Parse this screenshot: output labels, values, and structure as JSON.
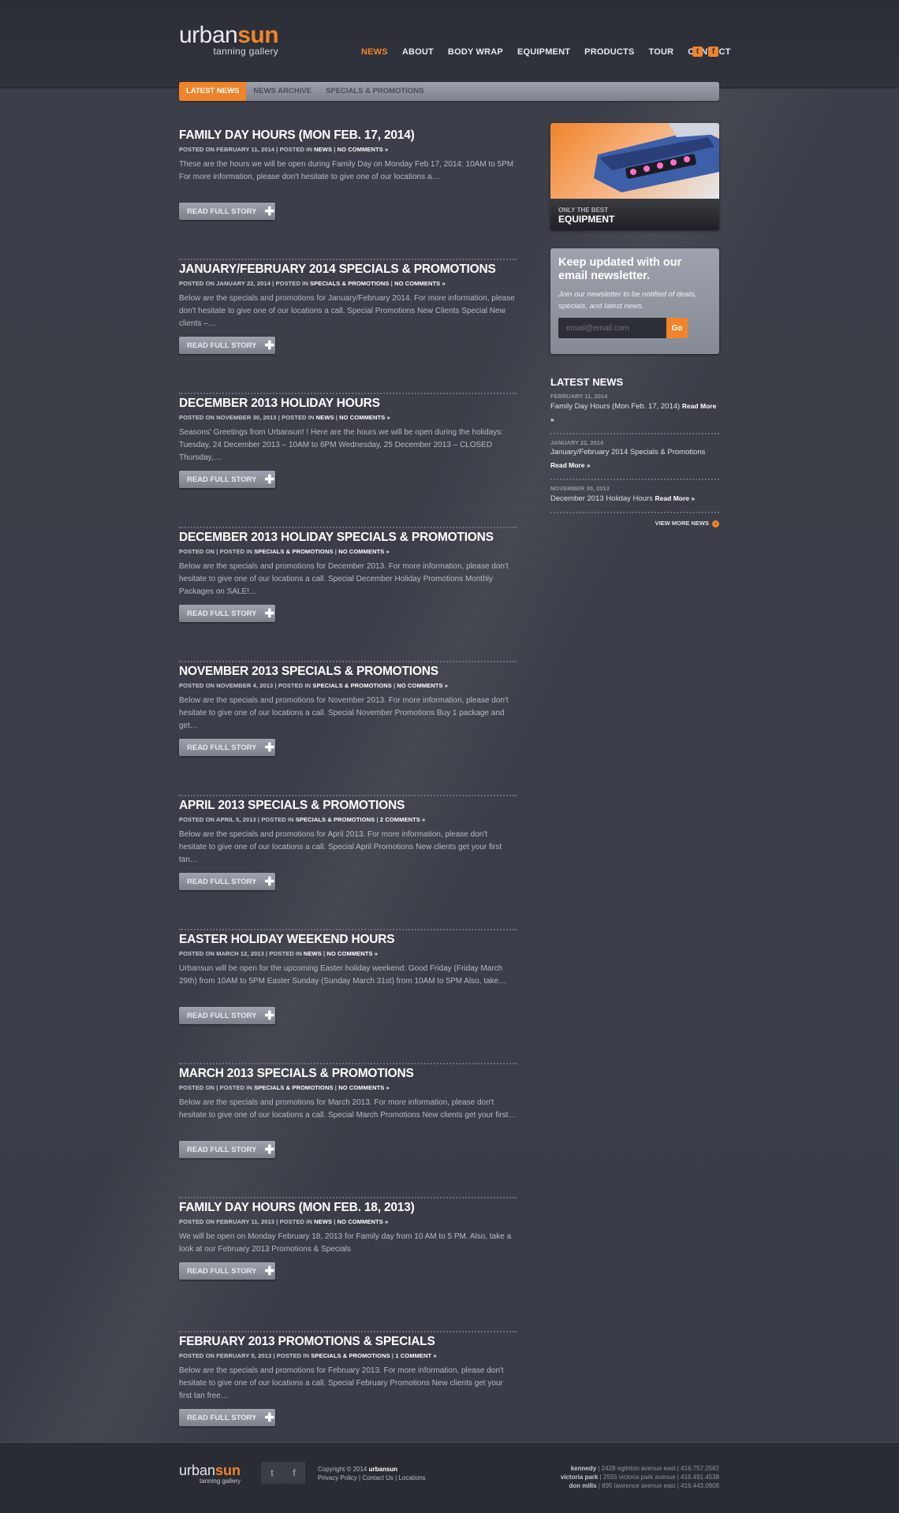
{
  "logo": {
    "word1": "urban",
    "word2": "sun",
    "tagline": "tanning gallery"
  },
  "nav": [
    "NEWS",
    "ABOUT",
    "BODY WRAP",
    "EQUIPMENT",
    "PRODUCTS",
    "TOUR",
    "CONTACT"
  ],
  "subnav": [
    "LATEST NEWS",
    "NEWS ARCHIVE",
    "SPECIALS & PROMOTIONS"
  ],
  "read_more_label": "READ FULL STORY",
  "posts": [
    {
      "title": "FAMILY DAY HOURS (MON FEB. 17, 2014)",
      "meta_prefix": "POSTED ON FEBRUARY 11, 2014 | POSTED IN ",
      "category": "NEWS",
      "comments": "NO COMMENTS »",
      "excerpt": "These are the hours we will be open during Family Day on Monday Feb 17, 2014: 10AM to 5PM For more information, please don't hesitate to give one of our locations a…"
    },
    {
      "title": "JANUARY/FEBRUARY 2014 SPECIALS & PROMOTIONS",
      "meta_prefix": "POSTED ON JANUARY 22, 2014 | POSTED IN ",
      "category": "SPECIALS & PROMOTIONS",
      "comments": "NO COMMENTS »",
      "excerpt": "Below are the specials and promotions for January/February 2014. For more information, please don't hesitate to give one of our locations a call.   Special Promotions New Clients Special New clients –…"
    },
    {
      "title": "DECEMBER 2013 HOLIDAY HOURS",
      "meta_prefix": "POSTED ON NOVEMBER 30, 2013 | POSTED IN ",
      "category": "NEWS",
      "comments": "NO COMMENTS »",
      "excerpt": "Seasons' Greetings from Urbansun! ! Here are the hours we will be open during the holidays: Tuesday, 24 December 2013 – 10AM to 6PM Wednesday, 25 December 2013 – CLOSED Thursday,…"
    },
    {
      "title": "DECEMBER 2013 HOLIDAY SPECIALS & PROMOTIONS",
      "meta_prefix": "POSTED ON | POSTED IN ",
      "category": "SPECIALS & PROMOTIONS",
      "comments": "NO COMMENTS »",
      "excerpt": "Below are the specials and promotions for December 2013. For more information, please don't hesitate to give one of our locations a call.   Special December Holiday Promotions Monthly Packages on SALE!…"
    },
    {
      "title": "NOVEMBER 2013 SPECIALS & PROMOTIONS",
      "meta_prefix": "POSTED ON NOVEMBER 4, 2013 | POSTED IN ",
      "category": "SPECIALS & PROMOTIONS",
      "comments": "NO COMMENTS »",
      "excerpt": "Below are the specials and promotions for November 2013. For more information, please don't hesitate to give one of our locations a call.   Special November Promotions Buy 1 package and get…"
    },
    {
      "title": "APRIL 2013 SPECIALS & PROMOTIONS",
      "meta_prefix": "POSTED ON APRIL 5, 2013 | POSTED IN ",
      "category": "SPECIALS & PROMOTIONS",
      "comments": "2 COMMENTS »",
      "excerpt": "Below are the specials and promotions for April 2013. For more information, please don't hesitate to give one of our locations a call.   Special April Promotions New clients get your first tan…"
    },
    {
      "title": "EASTER HOLIDAY WEEKEND HOURS",
      "meta_prefix": "POSTED ON MARCH 12, 2013 | POSTED IN ",
      "category": "NEWS",
      "comments": "NO COMMENTS »",
      "excerpt": "Urbansun will be open for the upcoming Easter holiday weekend: Good Friday (Friday March 29th) from 10AM to 5PM Easter Sunday (Sunday March 31st) from 10AM to 5PM Also, take…"
    },
    {
      "title": "MARCH 2013 SPECIALS & PROMOTIONS",
      "meta_prefix": "POSTED ON | POSTED IN ",
      "category": "SPECIALS & PROMOTIONS",
      "comments": "NO COMMENTS »",
      "excerpt": "Below are the specials and promotions for March 2013. For more information, please don't hesitate to give one of our locations a call.   Special March Promotions New clients get your first…"
    },
    {
      "title": "FAMILY DAY HOURS (MON FEB. 18, 2013)",
      "meta_prefix": "POSTED ON FEBRUARY 11, 2013 | POSTED IN ",
      "category": "NEWS",
      "comments": "NO COMMENTS »",
      "excerpt": "We will be open on Monday February 18, 2013 for Family day from 10 AM to 5 PM. Also, take a look at our February 2013 Promotions & Specials"
    },
    {
      "title": "FEBRUARY 2013 PROMOTIONS & SPECIALS",
      "meta_prefix": "POSTED ON FEBRUARY 5, 2013 | POSTED IN ",
      "category": "SPECIALS & PROMOTIONS",
      "comments": "1 COMMENT »",
      "excerpt": "Below are the specials and promotions for February 2013. For more information, please don't hesitate to give one of our locations a call. Special February Promotions New clients get your first tan free…"
    }
  ],
  "feature": {
    "small": "ONLY THE BEST",
    "big": "EQUIPMENT"
  },
  "newsletter": {
    "title": "Keep updated with our email newsletter.",
    "text": "Join our newsletter to be notified of deals, specials, and latest news.",
    "placeholder": "email@email.com",
    "go": "Go"
  },
  "latest": {
    "title": "LATEST NEWS",
    "items": [
      {
        "date": "FEBRUARY 11, 2014",
        "title": "Family Day Hours (Mon Feb. 17, 2014) ",
        "more": "Read More »"
      },
      {
        "date": "JANUARY 22, 2014",
        "title": "January/February 2014 Specials & Promotions ",
        "more": "Read More »"
      },
      {
        "date": "NOVEMBER 30, 2013",
        "title": "December 2013 Holiday Hours ",
        "more": "Read More »"
      }
    ],
    "view_more": "VIEW MORE NEWS"
  },
  "footer": {
    "copyright": "Copyright © 2014 ",
    "copyright_brand": "urbansun",
    "links": [
      "Privacy Policy",
      "Contact Us",
      "Locations"
    ],
    "locations": [
      {
        "name": "kennedy",
        "address": " | 2428 eglinton avenue east | 416.757.2582"
      },
      {
        "name": "victoria park",
        "address": " | 2555 victoria park avenue | 416.491.4538"
      },
      {
        "name": "don mills",
        "address": " | 895 lawrence avenue east | 416.443.0908"
      }
    ]
  },
  "colors": {
    "accent": "#f0842a",
    "background": "#3a3d47",
    "header": "#2b2e36"
  }
}
